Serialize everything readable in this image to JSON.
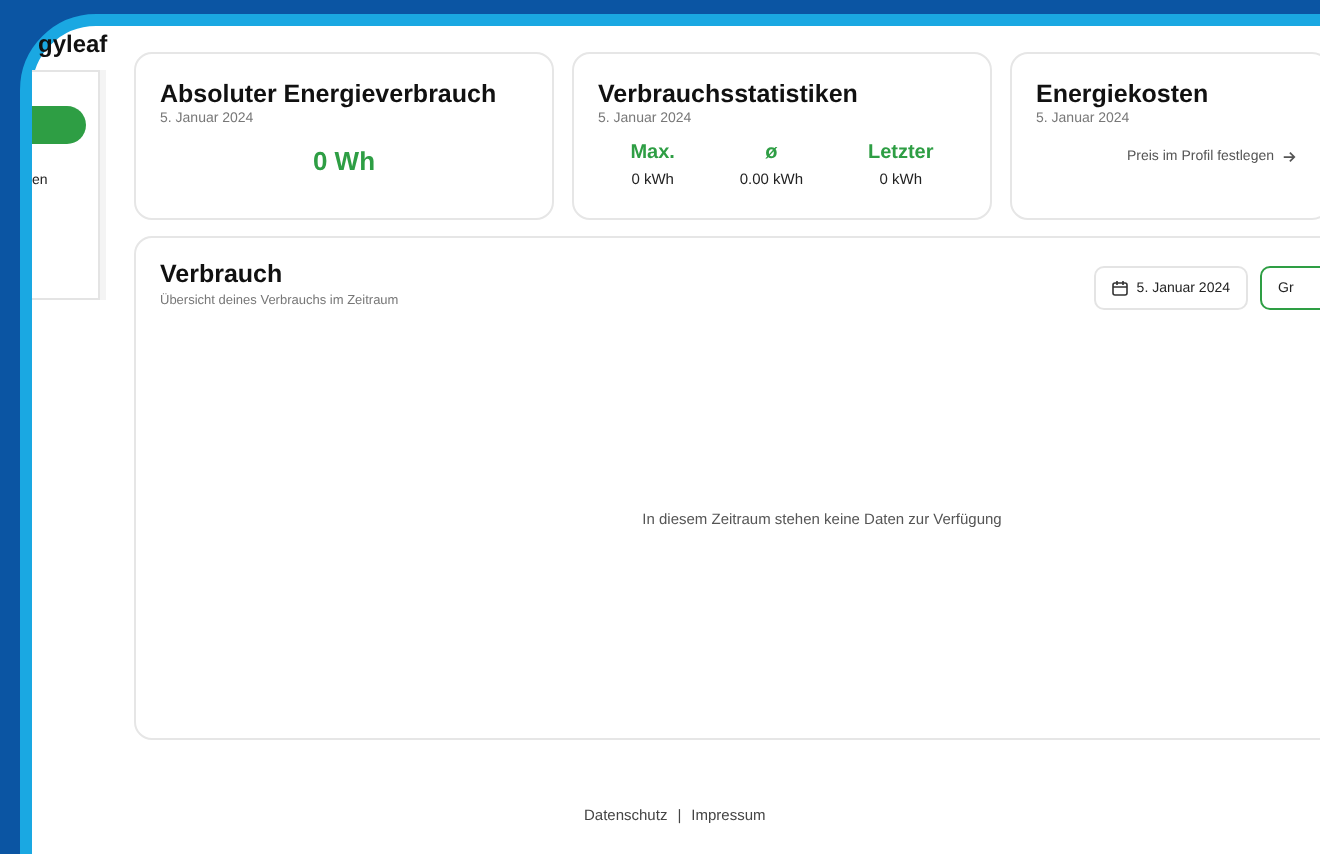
{
  "app": {
    "logo": "gyleaf"
  },
  "sidebar": {
    "items": [
      {
        "label": "en"
      }
    ]
  },
  "cards": [
    {
      "kind": "total",
      "title": "Absoluter Energieverbrauch",
      "date": "5. Januar 2024",
      "value": "0 Wh"
    },
    {
      "kind": "stats",
      "title": "Verbrauchsstatistiken",
      "date": "5. Januar 2024",
      "stats": [
        {
          "label": "Max.",
          "value": "0 kWh"
        },
        {
          "label": "ø",
          "value": "0.00 kWh"
        },
        {
          "label": "Letzter",
          "value": "0 kWh"
        }
      ]
    },
    {
      "kind": "costs",
      "title": "Energiekosten",
      "date": "5. Januar 2024",
      "link": "Preis im Profil festlegen"
    }
  ],
  "usage": {
    "title": "Verbrauch",
    "subtitle": "Übersicht deines Verbrauchs im Zeitraum",
    "date_button": "5. Januar 2024",
    "view_button": "Gr",
    "empty_message": "In diesem Zeitraum stehen keine Daten zur Verfügung"
  },
  "footer": {
    "links": [
      "Datenschutz",
      "Impressum"
    ],
    "separator": "|"
  }
}
